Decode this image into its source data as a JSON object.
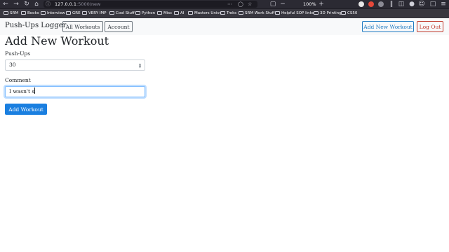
{
  "browser": {
    "url_host": "127.0.0.1",
    "url_path": ":5000/new",
    "zoom": "100%",
    "bookmarks": [
      "SRM",
      "Books",
      "Interview",
      "GRE",
      "VERY IMP",
      "Cool Stuff",
      "Python",
      "Misc",
      "AI",
      "Masters Univs",
      "Treks",
      "SRM Work Stuff",
      "Helpful SOP links",
      "3D Printing",
      "CS50"
    ]
  },
  "navbar": {
    "brand": "Push-Ups Logger",
    "all_workouts_label": "All Workouts",
    "account_label": "Account",
    "add_new_workout_label": "Add New Workout",
    "logout_label": "Log Out"
  },
  "form": {
    "title": "Add New Workout",
    "pushups_label": "Push-Ups",
    "pushups_value": "30",
    "comment_label": "Comment",
    "comment_value": "I wasn't s",
    "submit_label": "Add Workout"
  },
  "colors": {
    "primary": "#1a7fe0",
    "danger": "#c0392b",
    "navbar_bg": "#f8f9fa",
    "chrome_bg": "#2b2a33"
  }
}
